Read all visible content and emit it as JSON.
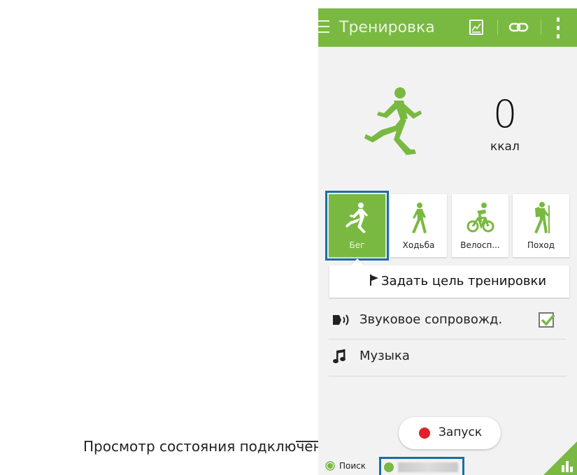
{
  "callout": {
    "text": "Просмотр состояния подключения."
  },
  "header": {
    "title": "Тренировка",
    "icons": [
      "menu-icon",
      "chart-icon",
      "link-icon",
      "more-vert-icon"
    ]
  },
  "summary": {
    "kcal_value": "0",
    "kcal_unit": "ккал"
  },
  "activities": [
    {
      "label": "Бег",
      "icon": "running-icon",
      "selected": true
    },
    {
      "label": "Ходьба",
      "icon": "walking-icon",
      "selected": false
    },
    {
      "label": "Велосп...",
      "icon": "cycling-icon",
      "selected": false
    },
    {
      "label": "Поход",
      "icon": "hiking-icon",
      "selected": false
    }
  ],
  "goal_button": {
    "label": "Задать цель тренировки",
    "icon": "flag-icon"
  },
  "audio_guide": {
    "label": "Звуковое сопровожд.",
    "checked": true,
    "icon": "audio-guide-icon"
  },
  "music": {
    "label": "Музыка",
    "icon": "music-note-icon"
  },
  "start_button": {
    "label": "Запуск"
  },
  "bottom_bar": {
    "search_label": "Поиск"
  },
  "colors": {
    "accent": "#79b941",
    "highlight_frame": "#1a6fa3",
    "start_dot": "#e0202a"
  }
}
